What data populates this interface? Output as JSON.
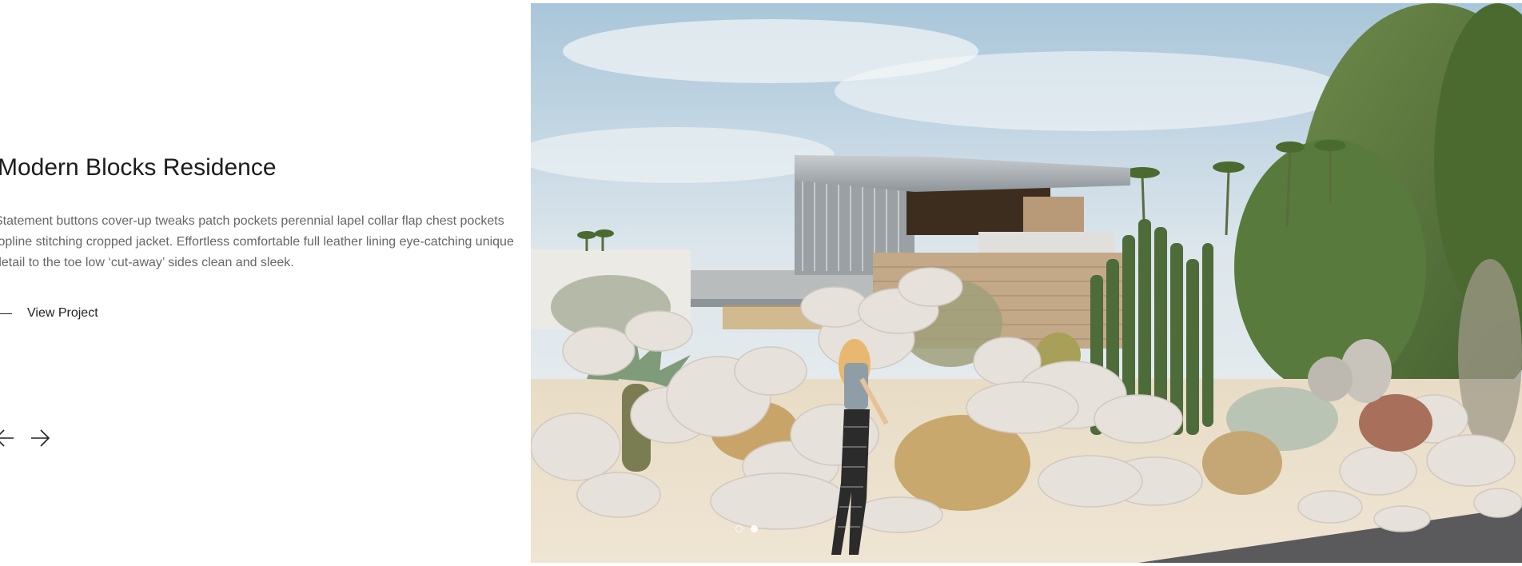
{
  "project": {
    "title": "Modern Blocks Residence",
    "description": "Statement buttons cover-up tweaks patch pockets perennial lapel collar flap chest pockets topline stitching cropped jacket. Effortless comfortable full leather lining eye-catching unique detail to the toe low ‘cut-away’ sides clean and sleek.",
    "view_label": "View Project"
  },
  "navigation": {
    "prev_icon": "arrow-left-icon",
    "next_icon": "arrow-right-icon"
  },
  "slider": {
    "slide_count": 2,
    "active_index": 1
  },
  "colors": {
    "title": "#1c1c1c",
    "body_text": "#666666",
    "link": "#222222",
    "background": "#ffffff"
  }
}
